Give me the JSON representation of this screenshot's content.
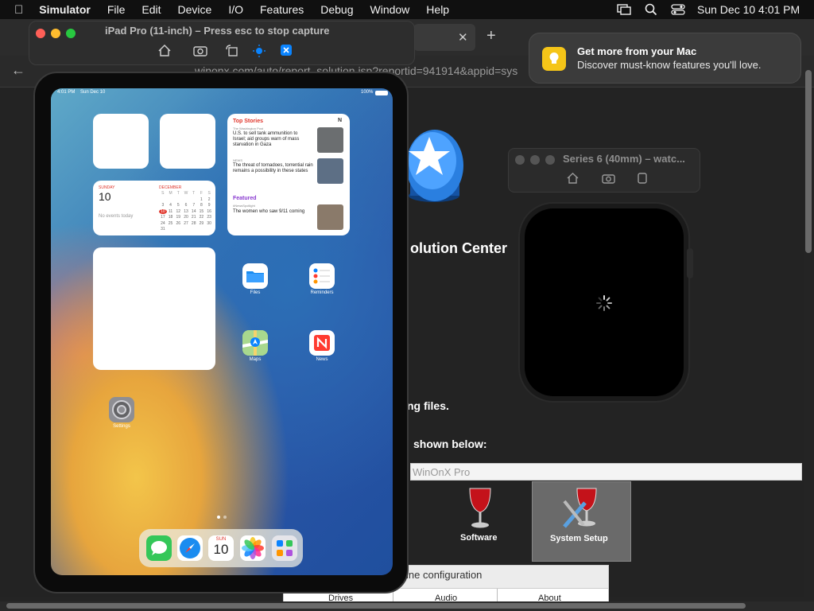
{
  "menubar": {
    "app": "Simulator",
    "items": [
      "File",
      "Edit",
      "Device",
      "I/O",
      "Features",
      "Debug",
      "Window",
      "Help"
    ],
    "datetime": "Sun Dec 10  4:01 PM"
  },
  "browser": {
    "url": "winonx.com/auto/report_solution.jsp?reportid=941914&appid=sys",
    "page_texts": {
      "heading": "olution Center",
      "line1": "ng files.",
      "line2": "shown below:",
      "app_name": "WinOnX Pro",
      "software": "Software",
      "system_setup": "System Setup",
      "config_title": "ine configuration",
      "tab_drives": "Drives",
      "tab_audio": "Audio",
      "tab_about": "About"
    }
  },
  "simulator": {
    "title": "iPad Pro (11-inch) – Press esc to stop capture"
  },
  "notification": {
    "title": "Get more from your Mac",
    "body": "Discover must-know features you'll love."
  },
  "ipad": {
    "status_time": "4:01 PM",
    "status_date": "Sun Dec 10",
    "battery": "100%",
    "calendar": {
      "weekday": "SUNDAY",
      "day": "10",
      "no_events": "No events today",
      "month": "DECEMBER",
      "weekday_letters": [
        "S",
        "M",
        "T",
        "W",
        "T",
        "F",
        "S"
      ],
      "days": [
        "",
        "",
        "",
        "",
        "",
        "1",
        "2",
        "3",
        "4",
        "5",
        "6",
        "7",
        "8",
        "9",
        "10",
        "11",
        "12",
        "13",
        "14",
        "15",
        "16",
        "17",
        "18",
        "19",
        "20",
        "21",
        "22",
        "23",
        "24",
        "25",
        "26",
        "27",
        "28",
        "29",
        "30",
        "31"
      ]
    },
    "news": {
      "top_stories": "Top Stories",
      "source1": "The Washington Post",
      "headline1": "U.S. to sell tank ammunition to Israel; aid groups warn of mass starvation in Gaza",
      "source2": "NEWS",
      "headline2": "The threat of tornadoes, torrential rain remains a possibility in these states",
      "featured": "Featured",
      "source3": "#NewsSpotlight",
      "headline3": "The women who saw 9/11 coming"
    },
    "apps": {
      "files": "Files",
      "reminders": "Reminders",
      "maps": "Maps",
      "news": "News",
      "settings": "Settings"
    },
    "dock_calendar_day": "SUN",
    "dock_calendar_num": "10"
  },
  "watch": {
    "title": "Series 6 (40mm) – watc..."
  },
  "colors": {
    "close": "#ff5f57",
    "minimize": "#febc2e",
    "zoom": "#28c840",
    "accent": "#0a84ff",
    "notif_icon": "#f5c518"
  }
}
